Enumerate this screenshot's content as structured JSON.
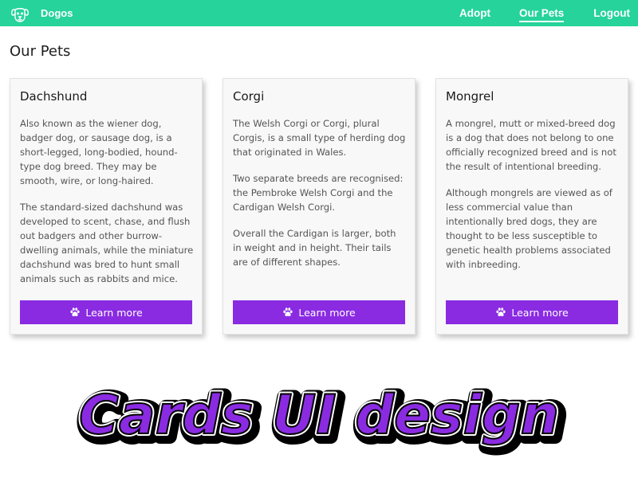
{
  "nav": {
    "brand": "Dogos",
    "links": [
      "Adopt",
      "Our Pets",
      "Logout"
    ],
    "active": "Our Pets",
    "bg": "#26d39a"
  },
  "page": {
    "title": "Our Pets"
  },
  "cards": [
    {
      "title": "Dachshund",
      "paragraphs": [
        "Also known as the wiener dog, badger dog, or sausage dog, is a short-legged, long-bodied, hound-type dog breed. They may be smooth, wire, or long-haired.",
        "The standard-sized dachshund was developed to scent, chase, and flush out badgers and other burrow-dwelling animals, while the miniature dachshund was bred to hunt small animals such as rabbits and mice."
      ],
      "button": "Learn more"
    },
    {
      "title": "Corgi",
      "paragraphs": [
        "The Welsh Corgi or Corgi, plural Corgis, is a small type of herding dog that originated in Wales.",
        "Two separate breeds are recognised: the Pembroke Welsh Corgi and the Cardigan Welsh Corgi.",
        "Overall the Cardigan is larger, both in weight and in height. Their tails are of different shapes."
      ],
      "button": "Learn more"
    },
    {
      "title": "Mongrel",
      "paragraphs": [
        "A mongrel, mutt or mixed-breed dog is a dog that does not belong to one officially recognized breed and is not the result of intentional breeding.",
        "Although mongrels are viewed as of less commercial value than intentionally bred dogs, they are thought to be less susceptible to genetic health problems associated with inbreeding."
      ],
      "button": "Learn more"
    }
  ],
  "banner": {
    "text": "Cards UI design",
    "fill": "#8a2be2",
    "stroke": "#000000"
  },
  "colors": {
    "accent": "#8a2be2",
    "card_bg": "#f8f8f8"
  },
  "icons": {
    "brand": "dog-face-icon",
    "button": "paw-icon"
  }
}
